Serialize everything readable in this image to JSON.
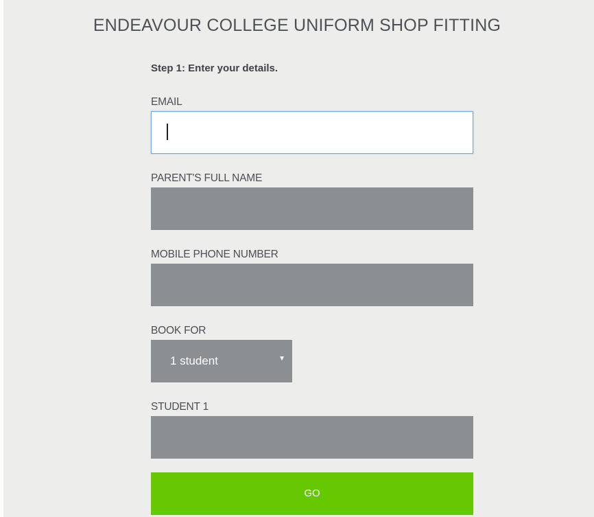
{
  "page": {
    "title": "ENDEAVOUR COLLEGE UNIFORM SHOP FITTING",
    "step": "Step 1: Enter your details."
  },
  "form": {
    "email": {
      "label": "EMAIL",
      "value": "",
      "placeholder": ""
    },
    "parent_name": {
      "label": "PARENT'S FULL NAME",
      "value": "",
      "placeholder": ""
    },
    "mobile": {
      "label": "MOBILE PHONE NUMBER",
      "value": "",
      "placeholder": ""
    },
    "book_for": {
      "label": "BOOK FOR",
      "selected": "1 student",
      "arrow_icon": "triangle-down-icon"
    },
    "student1": {
      "label": "STUDENT 1",
      "value": "",
      "placeholder": ""
    },
    "submit_label": "GO"
  },
  "colors": {
    "background": "#ededeb",
    "field_fill": "#8b8f92",
    "focus_border": "#78a7e8",
    "submit": "#66c900",
    "text": "#4b4f55"
  }
}
